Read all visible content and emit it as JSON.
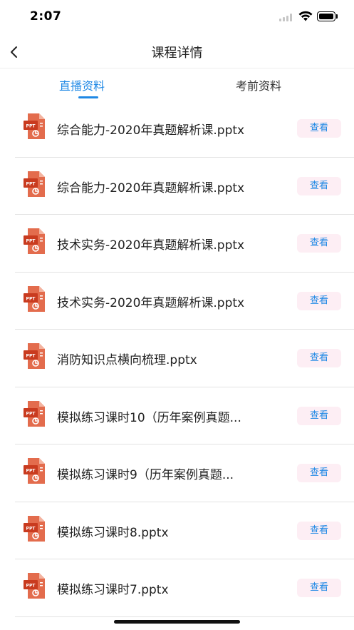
{
  "status": {
    "time": "2:07"
  },
  "nav": {
    "title": "课程详情"
  },
  "tabs": [
    {
      "label": "直播资料",
      "active": true
    },
    {
      "label": "考前资料",
      "active": false
    }
  ],
  "files": [
    {
      "name": "综合能力-2020年真题解析课.pptx",
      "action": "查看"
    },
    {
      "name": "综合能力-2020年真题解析课.pptx",
      "action": "查看"
    },
    {
      "name": "技术实务-2020年真题解析课.pptx",
      "action": "查看"
    },
    {
      "name": "技术实务-2020年真题解析课.pptx",
      "action": "查看"
    },
    {
      "name": "消防知识点横向梳理.pptx",
      "action": "查看"
    },
    {
      "name": "模拟练习课时10（历年案例真题...",
      "action": "查看"
    },
    {
      "name": "模拟练习课时9（历年案例真题...",
      "action": "查看"
    },
    {
      "name": "模拟练习课时8.pptx",
      "action": "查看"
    },
    {
      "name": "模拟练习课时7.pptx",
      "action": "查看"
    }
  ],
  "icons": {
    "file": "ppt-file-icon",
    "back": "chevron-left-icon"
  },
  "colors": {
    "accent": "#1e88e5",
    "ppt": "#d9472b",
    "view_bg": "#fdeef4"
  }
}
